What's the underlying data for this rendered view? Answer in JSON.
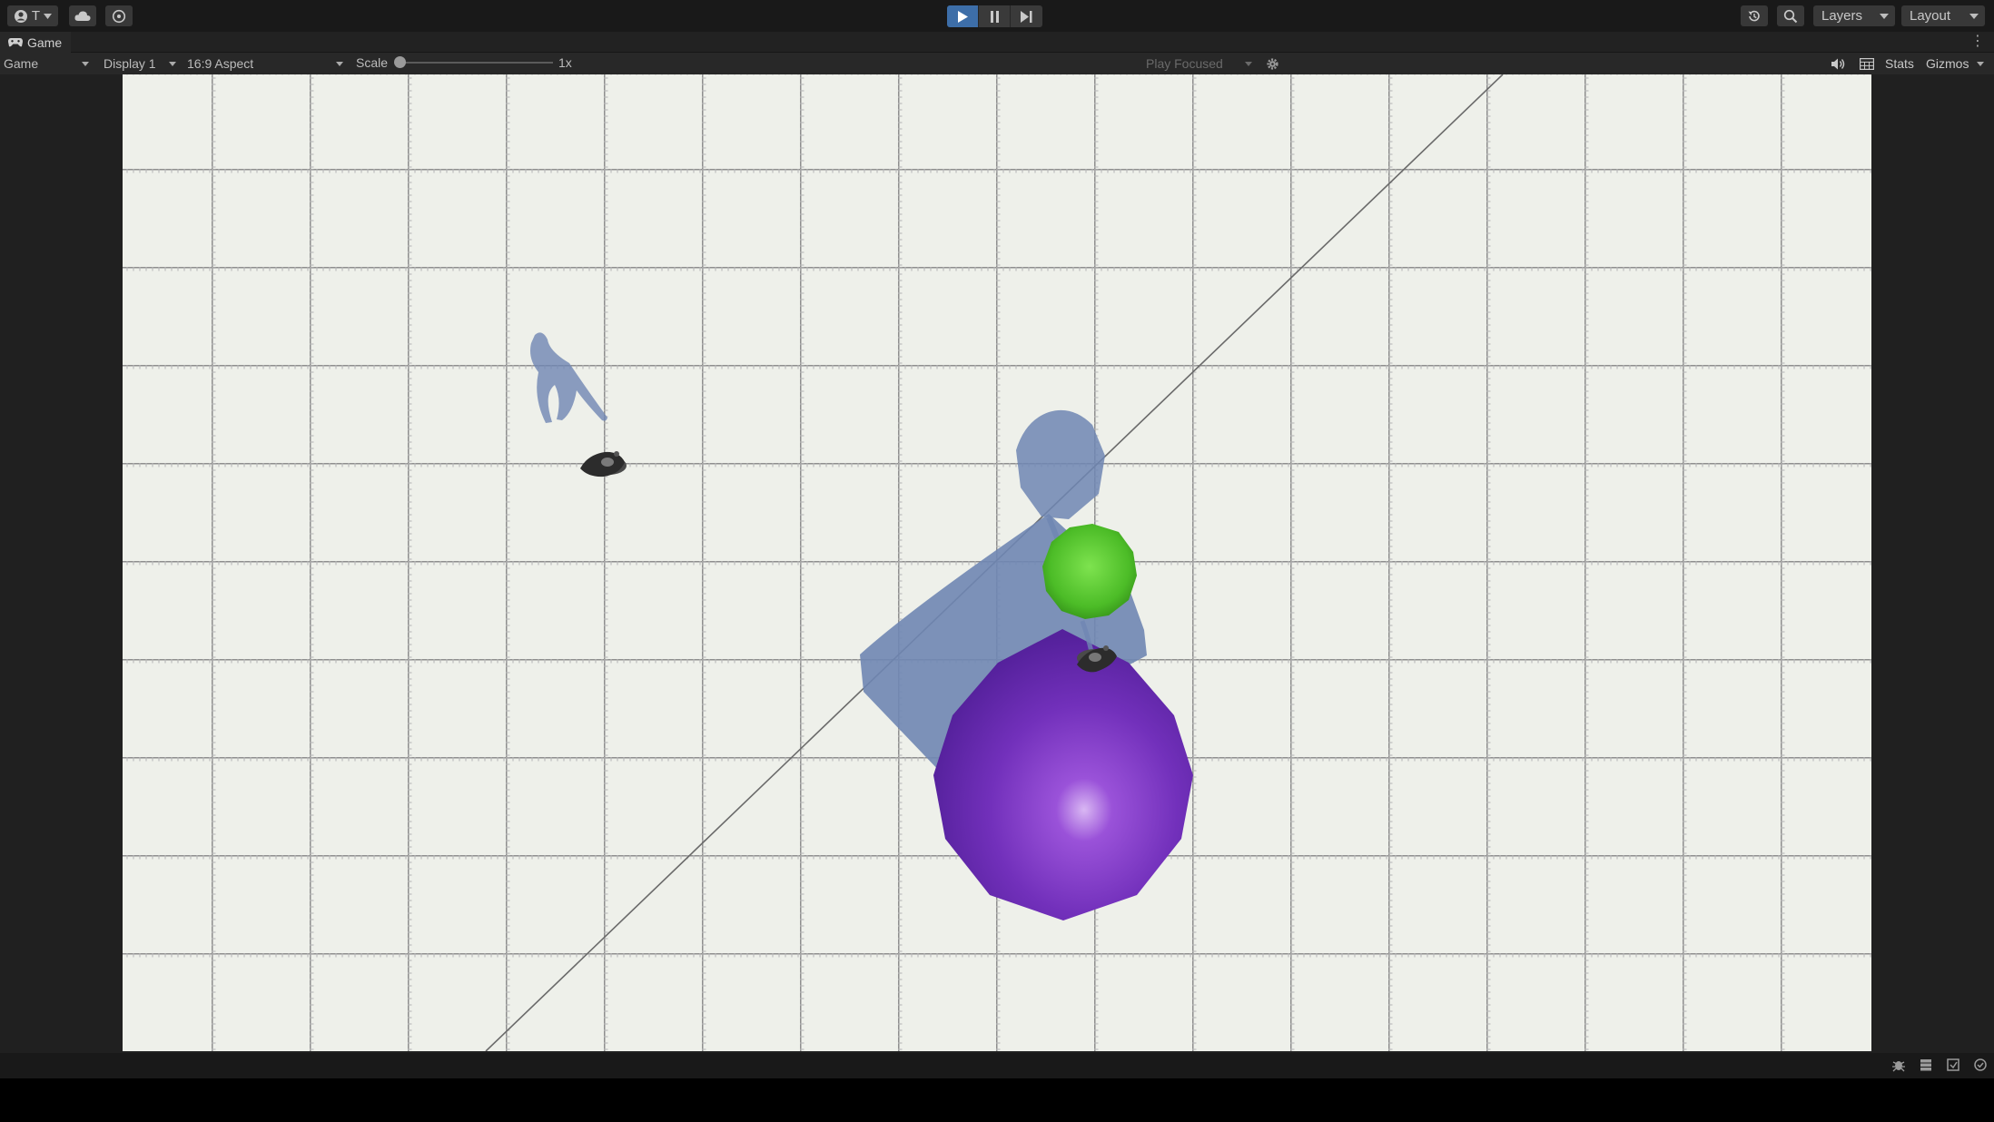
{
  "toolbar": {
    "account_label": "T",
    "layers_label": "Layers",
    "layout_label": "Layout"
  },
  "tab": {
    "title": "Game"
  },
  "controls": {
    "mode": "Game",
    "display": "Display 1",
    "aspect": "16:9 Aspect",
    "scale_label": "Scale",
    "scale_value": "1x",
    "play_mode": "Play Focused",
    "stats_label": "Stats",
    "gizmos_label": "Gizmos"
  },
  "scene": {
    "floor_color": "#eef0ea",
    "grid_color": "#8e8e8e",
    "shadow_color": "#6f86b3",
    "purple_sphere_color": "#7a2fc0",
    "green_sphere_color": "#4fbf2a",
    "character_color": "#2c2c2c"
  },
  "colors": {
    "play_active": "#3d6ea8",
    "toolbar_bg": "#191919",
    "panel_bg": "#282828"
  }
}
